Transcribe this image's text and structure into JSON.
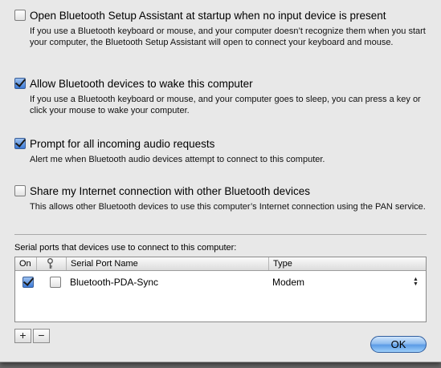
{
  "options": [
    {
      "label": "Open Bluetooth Setup Assistant at startup when no input device is present",
      "checked": false,
      "description": "If you use a Bluetooth keyboard or mouse, and your computer doesn’t recognize them when you start your computer, the Bluetooth Setup Assistant will open to connect your keyboard and mouse."
    },
    {
      "label": "Allow Bluetooth devices to wake this computer",
      "checked": true,
      "description": "If you use a Bluetooth keyboard or mouse, and your computer goes to sleep, you can press a key or click your mouse to wake your computer."
    },
    {
      "label": "Prompt for all incoming audio requests",
      "checked": true,
      "description": "Alert me when Bluetooth audio devices attempt to connect to this computer."
    },
    {
      "label": "Share my Internet connection with other Bluetooth devices",
      "checked": false,
      "description": "This allows other Bluetooth devices to use this computer’s Internet connection using the PAN service."
    }
  ],
  "serial": {
    "label": "Serial ports that devices use to connect to this computer:",
    "columns": {
      "on": "On",
      "key": "",
      "name": "Serial Port Name",
      "type": "Type"
    },
    "rows": [
      {
        "on": true,
        "key": false,
        "name": "Bluetooth-PDA-Sync",
        "type": "Modem"
      }
    ],
    "add_label": "+",
    "remove_label": "−"
  },
  "ok_label": "OK",
  "colors": {
    "accent": "#3b7ad8",
    "ok_button": "#5b9be6"
  }
}
